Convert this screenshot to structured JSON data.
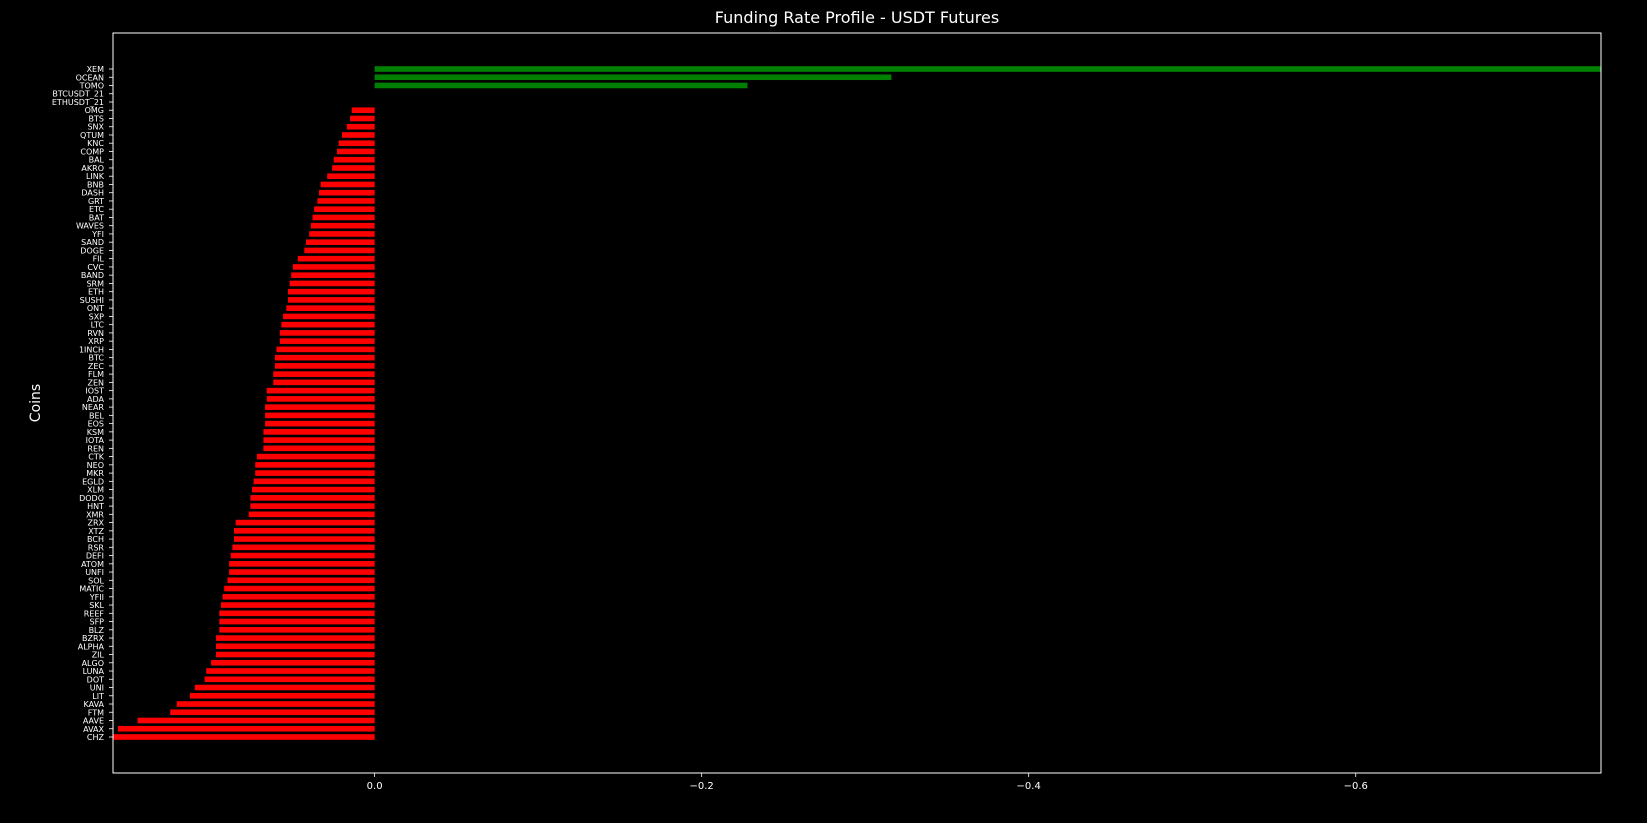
{
  "chart_data": {
    "type": "bar",
    "orientation": "horizontal",
    "title": "Funding Rate Profile - USDT Futures",
    "xlabel": "",
    "ylabel": "Coins",
    "x_axis_inverted": true,
    "xlim": [
      0.16,
      -0.75
    ],
    "x_ticks": [
      0.0,
      -0.2,
      -0.4,
      -0.6
    ],
    "x_tick_labels": [
      "0.0",
      "−0.2",
      "−0.4",
      "−0.6"
    ],
    "grid": false,
    "background": "#000000",
    "colors": {
      "positive": "#008000",
      "negative": "#ff0000",
      "text": "#ffffff",
      "axes": "#ffffff"
    },
    "bars": [
      {
        "label": "XEM",
        "value": -0.75
      },
      {
        "label": "OCEAN",
        "value": -0.316
      },
      {
        "label": "TOMO",
        "value": -0.228
      },
      {
        "label": "BTCUSDT_21",
        "value": 0.0
      },
      {
        "label": "ETHUSDT_21",
        "value": 0.0
      },
      {
        "label": "OMG",
        "value": 0.014
      },
      {
        "label": "BTS",
        "value": 0.015
      },
      {
        "label": "SNX",
        "value": 0.017
      },
      {
        "label": "QTUM",
        "value": 0.02
      },
      {
        "label": "KNC",
        "value": 0.022
      },
      {
        "label": "COMP",
        "value": 0.023
      },
      {
        "label": "BAL",
        "value": 0.025
      },
      {
        "label": "AKRO",
        "value": 0.026
      },
      {
        "label": "LINK",
        "value": 0.029
      },
      {
        "label": "BNB",
        "value": 0.033
      },
      {
        "label": "DASH",
        "value": 0.034
      },
      {
        "label": "GRT",
        "value": 0.035
      },
      {
        "label": "ETC",
        "value": 0.037
      },
      {
        "label": "BAT",
        "value": 0.038
      },
      {
        "label": "WAVES",
        "value": 0.039
      },
      {
        "label": "YFI",
        "value": 0.04
      },
      {
        "label": "SAND",
        "value": 0.042
      },
      {
        "label": "DOGE",
        "value": 0.043
      },
      {
        "label": "FIL",
        "value": 0.047
      },
      {
        "label": "CVC",
        "value": 0.05
      },
      {
        "label": "BAND",
        "value": 0.051
      },
      {
        "label": "SRM",
        "value": 0.052
      },
      {
        "label": "ETH",
        "value": 0.053
      },
      {
        "label": "SUSHI",
        "value": 0.053
      },
      {
        "label": "ONT",
        "value": 0.054
      },
      {
        "label": "SXP",
        "value": 0.056
      },
      {
        "label": "LTC",
        "value": 0.057
      },
      {
        "label": "RVN",
        "value": 0.058
      },
      {
        "label": "XRP",
        "value": 0.058
      },
      {
        "label": "1INCH",
        "value": 0.06
      },
      {
        "label": "BTC",
        "value": 0.061
      },
      {
        "label": "ZEC",
        "value": 0.061
      },
      {
        "label": "FLM",
        "value": 0.062
      },
      {
        "label": "ZEN",
        "value": 0.062
      },
      {
        "label": "IOST",
        "value": 0.066
      },
      {
        "label": "ADA",
        "value": 0.066
      },
      {
        "label": "NEAR",
        "value": 0.067
      },
      {
        "label": "BEL",
        "value": 0.067
      },
      {
        "label": "EOS",
        "value": 0.067
      },
      {
        "label": "KSM",
        "value": 0.068
      },
      {
        "label": "IOTA",
        "value": 0.068
      },
      {
        "label": "REN",
        "value": 0.068
      },
      {
        "label": "CTK",
        "value": 0.072
      },
      {
        "label": "NEO",
        "value": 0.073
      },
      {
        "label": "MKR",
        "value": 0.073
      },
      {
        "label": "EGLD",
        "value": 0.074
      },
      {
        "label": "XLM",
        "value": 0.075
      },
      {
        "label": "DODO",
        "value": 0.076
      },
      {
        "label": "HNT",
        "value": 0.076
      },
      {
        "label": "XMR",
        "value": 0.077
      },
      {
        "label": "ZRX",
        "value": 0.085
      },
      {
        "label": "XTZ",
        "value": 0.086
      },
      {
        "label": "BCH",
        "value": 0.086
      },
      {
        "label": "RSR",
        "value": 0.087
      },
      {
        "label": "DEFI",
        "value": 0.088
      },
      {
        "label": "ATOM",
        "value": 0.089
      },
      {
        "label": "UNFI",
        "value": 0.089
      },
      {
        "label": "SOL",
        "value": 0.09
      },
      {
        "label": "MATIC",
        "value": 0.092
      },
      {
        "label": "YFII",
        "value": 0.093
      },
      {
        "label": "SKL",
        "value": 0.094
      },
      {
        "label": "REEF",
        "value": 0.095
      },
      {
        "label": "SFP",
        "value": 0.095
      },
      {
        "label": "BLZ",
        "value": 0.095
      },
      {
        "label": "BZRX",
        "value": 0.097
      },
      {
        "label": "ALPHA",
        "value": 0.097
      },
      {
        "label": "ZIL",
        "value": 0.097
      },
      {
        "label": "ALGO",
        "value": 0.1
      },
      {
        "label": "LUNA",
        "value": 0.103
      },
      {
        "label": "DOT",
        "value": 0.104
      },
      {
        "label": "UNI",
        "value": 0.11
      },
      {
        "label": "LIT",
        "value": 0.113
      },
      {
        "label": "KAVA",
        "value": 0.121
      },
      {
        "label": "FTM",
        "value": 0.125
      },
      {
        "label": "AAVE",
        "value": 0.145
      },
      {
        "label": "AVAX",
        "value": 0.157
      },
      {
        "label": "CHZ",
        "value": 0.16
      }
    ]
  }
}
